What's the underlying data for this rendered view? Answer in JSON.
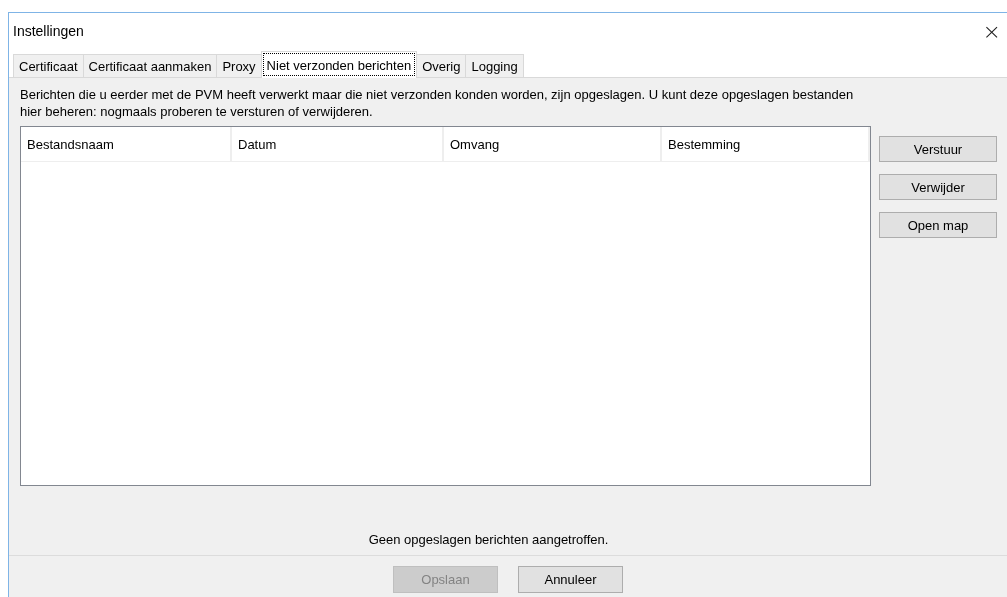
{
  "window": {
    "title": "Instellingen",
    "close": "×"
  },
  "tabs": [
    {
      "label": "Certificaat",
      "selected": false
    },
    {
      "label": "Certificaat aanmaken",
      "selected": false
    },
    {
      "label": "Proxy",
      "selected": false
    },
    {
      "label": "Niet verzonden berichten",
      "selected": true
    },
    {
      "label": "Overig",
      "selected": false
    },
    {
      "label": "Logging",
      "selected": false
    }
  ],
  "description": "Berichten die u eerder met de PVM heeft verwerkt maar die niet verzonden konden worden, zijn opgeslagen. U kunt deze opgeslagen bestanden hier beheren: nogmaals proberen te versturen of verwijderen.",
  "table": {
    "columns": [
      "Bestandsnaam",
      "Datum",
      "Omvang",
      "Bestemming"
    ]
  },
  "side_buttons": [
    "Verstuur",
    "Verwijder",
    "Open map"
  ],
  "status": "Geen opgeslagen berichten aangetroffen.",
  "footer_buttons": [
    {
      "label": "Opslaan",
      "disabled": true
    },
    {
      "label": "Annuleer",
      "disabled": false
    }
  ]
}
